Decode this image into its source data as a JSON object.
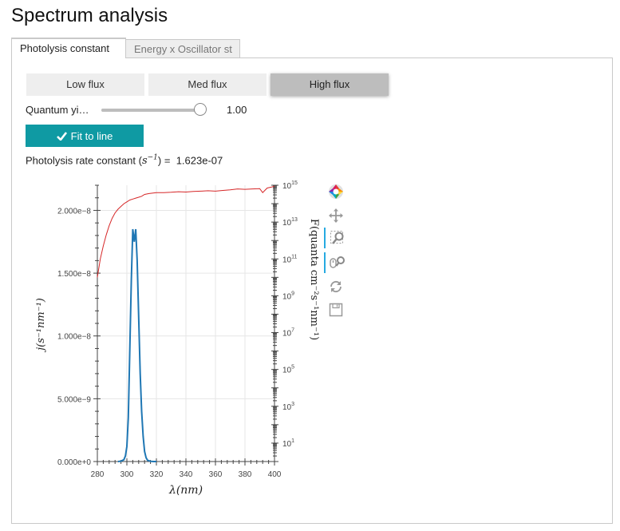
{
  "page": {
    "title": "Spectrum analysis"
  },
  "tabs": [
    {
      "label": "Photolysis constant",
      "active": true
    },
    {
      "label": "Energy x Oscillator st",
      "active": false
    }
  ],
  "flux_buttons": [
    {
      "label": "Low flux",
      "active": false
    },
    {
      "label": "Med flux",
      "active": false
    },
    {
      "label": "High flux",
      "active": true
    }
  ],
  "slider": {
    "label": "Quantum yi…",
    "value_text": "1.00",
    "value": 1.0,
    "min": 0,
    "max": 1
  },
  "fit_button": {
    "label": "Fit to line",
    "icon": "check-icon"
  },
  "rate": {
    "label_before": "Photolysis rate constant (",
    "symbol": "s",
    "exponent": "−1",
    "label_after": ") =",
    "value": "1.623e-07"
  },
  "toolbar": [
    "bokeh-logo-icon",
    "pan-icon",
    "box-zoom-icon",
    "wheel-zoom-icon",
    "reset-icon",
    "save-icon"
  ],
  "colors": {
    "accent": "#0f9aa3",
    "tab_active_border": "#4a90d9",
    "flux_line": "#d62728",
    "j_line": "#1f77b4",
    "tool_active": "#26aae1"
  },
  "chart_data": {
    "type": "line",
    "xlabel": "λ(nm)",
    "ylabel_left": "j(s⁻¹nm⁻¹)",
    "ylabel_right": "F(quanta cm⁻²s⁻¹nm⁻¹)",
    "xlim": [
      280,
      400
    ],
    "ylim_left": [
      0,
      2.2e-08
    ],
    "ylim_right_log10": [
      0,
      15
    ],
    "grid": true,
    "x_ticks": [
      "280",
      "300",
      "320",
      "340",
      "360",
      "380",
      "400"
    ],
    "y_left_ticks": [
      "0.000e+0",
      "5.000e−9",
      "1.000e−8",
      "1.500e−8",
      "2.000e−8"
    ],
    "y_right_tick_mantissa": "10",
    "y_right_tick_exponents": [
      "1",
      "3",
      "5",
      "7",
      "9",
      "11",
      "13",
      "15"
    ],
    "series": [
      {
        "axis": "left",
        "x": [
          294,
          296,
          298,
          299,
          300,
          301,
          302,
          303,
          304,
          305,
          306,
          307,
          308,
          309,
          310,
          311,
          312,
          313,
          314,
          316,
          318,
          320
        ],
        "y": [
          0,
          3e-11,
          1.5e-10,
          4.5e-10,
          1.2e-09,
          3.5e-09,
          9e-09,
          1.45e-08,
          1.85e-08,
          1.75e-08,
          1.85e-08,
          1.6e-08,
          1.15e-08,
          7e-09,
          4e-09,
          2e-09,
          8e-10,
          3e-10,
          1e-10,
          2e-11,
          0,
          0
        ]
      },
      {
        "axis": "right",
        "x": [
          280,
          282,
          284,
          286,
          288,
          290,
          292,
          294,
          296,
          298,
          300,
          302,
          304,
          306,
          308,
          310,
          312,
          315,
          320,
          325,
          330,
          335,
          340,
          345,
          350,
          355,
          360,
          365,
          370,
          375,
          380,
          385,
          390,
          392,
          395,
          398,
          400
        ],
        "y": [
          10.0,
          11.0,
          11.7,
          12.3,
          12.8,
          13.2,
          13.5,
          13.7,
          13.85,
          14.0,
          14.1,
          14.2,
          14.25,
          14.3,
          14.35,
          14.4,
          14.5,
          14.55,
          14.6,
          14.6,
          14.62,
          14.65,
          14.63,
          14.66,
          14.68,
          14.7,
          14.68,
          14.72,
          14.75,
          14.8,
          14.78,
          14.8,
          14.82,
          14.6,
          14.85,
          14.9,
          14.95
        ]
      }
    ]
  }
}
